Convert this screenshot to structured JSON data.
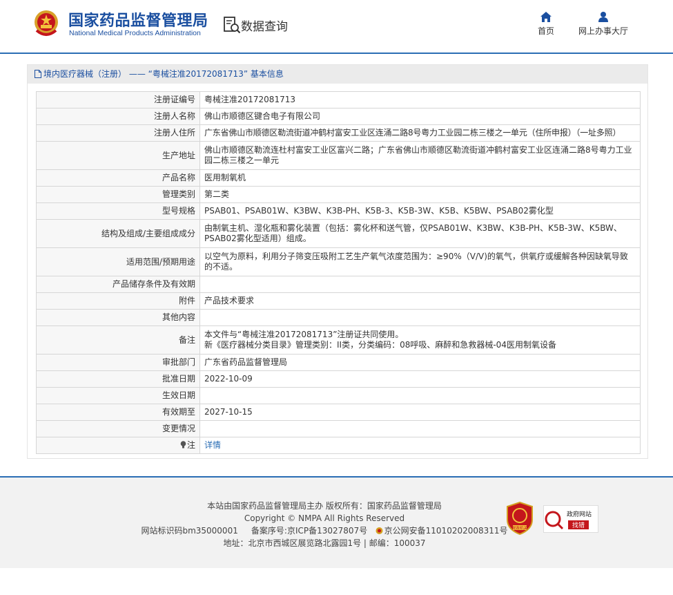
{
  "header": {
    "brand_cn": "国家药品监督管理局",
    "brand_en": "National Medical Products Administration",
    "query_label": "数据查询",
    "nav": [
      {
        "label": "首页",
        "icon": "home-icon"
      },
      {
        "label": "网上办事大厅",
        "icon": "user-icon"
      }
    ]
  },
  "panel": {
    "title": "境内医疗器械（注册） —— “粤械注准20172081713” 基本信息",
    "rows": [
      {
        "label": "注册证编号",
        "value": "粤械注准20172081713"
      },
      {
        "label": "注册人名称",
        "value": "佛山市顺德区键合电子有限公司"
      },
      {
        "label": "注册人住所",
        "value": "广东省佛山市顺德区勒流街道冲鹤村富安工业区连涌二路8号粤力工业园二栋三楼之一单元（住所申报）（一址多照）"
      },
      {
        "label": "生产地址",
        "value": "佛山市顺德区勒流连杜村富安工业区富兴二路；广东省佛山市顺德区勒流街道冲鹤村富安工业区连涌二路8号粤力工业园二栋三楼之一单元"
      },
      {
        "label": "产品名称",
        "value": "医用制氧机"
      },
      {
        "label": "管理类别",
        "value": "第二类"
      },
      {
        "label": "型号规格",
        "value": "PSAB01、PSAB01W、K3BW、K3B-PH、K5B-3、K5B-3W、K5B、K5BW、PSAB02雾化型"
      },
      {
        "label": "结构及组成/主要组成成分",
        "value": "由制氧主机、湿化瓶和雾化装置（包括：雾化杯和送气管，仅PSAB01W、K3BW、K3B-PH、K5B-3W、K5BW、PSAB02雾化型适用）组成。"
      },
      {
        "label": "适用范围/预期用途",
        "value": "以空气为原料，利用分子筛变压吸附工艺生产氧气浓度范围为：≥90%（V/V)的氧气，供氧疗或缓解各种因缺氧导致的不适。"
      },
      {
        "label": "产品储存条件及有效期",
        "value": ""
      },
      {
        "label": "附件",
        "value": "产品技术要求"
      },
      {
        "label": "其他内容",
        "value": ""
      },
      {
        "label": "备注",
        "value": "本文件与“粤械注准20172081713”注册证共同使用。",
        "value2": "新《医疗器械分类目录》管理类别：II类，分类编码：08呼吸、麻醉和急救器械-04医用制氧设备"
      },
      {
        "label": "审批部门",
        "value": "广东省药品监督管理局"
      },
      {
        "label": "批准日期",
        "value": "2022-10-09"
      },
      {
        "label": "生效日期",
        "value": ""
      },
      {
        "label": "有效期至",
        "value": "2027-10-15"
      },
      {
        "label": "变更情况",
        "value": ""
      },
      {
        "label": "注",
        "value": "详情"
      }
    ]
  },
  "footer": {
    "line1": "本站由国家药品监督管理局主办 版权所有：国家药品监督管理局",
    "line2": "Copyright © NMPA All Rights Reserved",
    "site_id": "网站标识码bm35000001",
    "icp": "备案序号:京ICP备13027807号",
    "police": "京公网安备11010202008311号",
    "address": "地址：北京市西城区展览路北露园1号 | 邮编：100037",
    "badge_party": "党政机关",
    "badge_gov_top": "政府网站",
    "badge_gov_bottom": "找错"
  },
  "colors": {
    "brand_blue": "#1b4fa0",
    "rule_blue": "#2a6db4",
    "link_blue": "#2a6db4",
    "badge_red": "#c4161c"
  }
}
